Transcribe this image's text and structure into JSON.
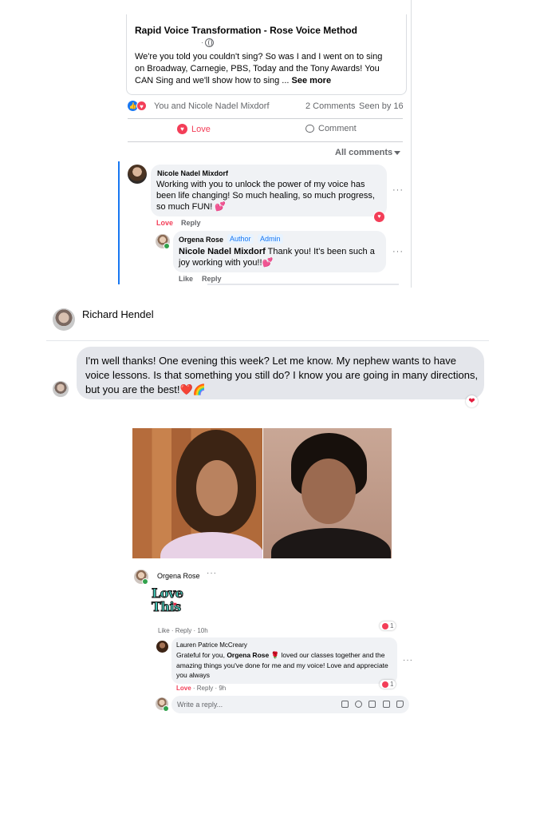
{
  "post": {
    "title": "Rapid Voice Transformation - Rose Voice Method",
    "dot": "·",
    "body": "We're you told you couldn't sing? So was I and I went on to sing on Broadway,  Carnegie, PBS, Today and the Tony Awards! You CAN Sing and we'll show how to sing ...",
    "see_more": "See more",
    "reactions_text": "You and Nicole Nadel Mixdorf",
    "comments_count": "2 Comments",
    "seen_by": "Seen by 16",
    "love_label": "Love",
    "comment_label": "Comment",
    "all_comments": "All comments"
  },
  "comment1": {
    "author": "Nicole Nadel Mixdorf",
    "text": "Working with you to unlock the power of my voice has been life changing! So much healing, so much progress, so much FUN! 💕",
    "love": "Love",
    "reply": "Reply",
    "more": "···"
  },
  "reply1": {
    "author": "Orgena Rose",
    "badge_author": "Author",
    "badge_admin": "Admin",
    "mention": "Nicole Nadel Mixdorf",
    "text": " Thank you! It's been such a joy working with you!!💕",
    "like": "Like",
    "reply": "Reply",
    "more": "···"
  },
  "messenger": {
    "contact_name": "Richard Hendel",
    "message": "I'm well thanks! One evening this week? Let me know. My nephew wants to have voice lessons. Is that something you still do? I know you are going in many directions, but you are the best!❤️🌈",
    "reaction": "❤"
  },
  "photo_post": {
    "commenter": "Orgena Rose",
    "more": "···",
    "sticker_line1": "Love",
    "sticker_line2": "This",
    "meta": "Like · Reply · 10h",
    "react_count_1": "1",
    "reply_author": "Lauren Patrice McCreary",
    "reply_text_pre": "Grateful for you, ",
    "reply_mention": "Orgena Rose",
    "reply_text_post": " 🌹 loved our classes together and the amazing things you've done for me and my voice! Love and appreciate you always",
    "reply_meta_love": "Love",
    "reply_meta_rest": " · Reply · 9h",
    "react_count_2": "1",
    "reply_placeholder": "Write a reply...",
    "reply_more": "···"
  },
  "colors": {
    "facebook_blue": "#1877f2",
    "love_red": "#f33e58",
    "bubble_gray": "#f0f2f5"
  }
}
